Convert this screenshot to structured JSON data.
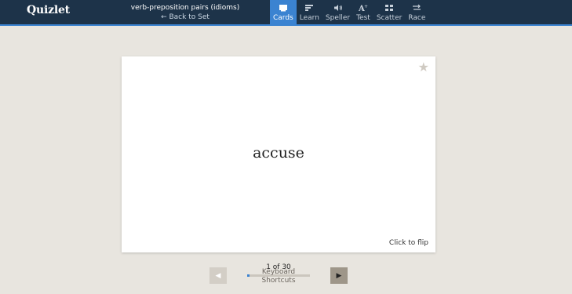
{
  "header": {
    "logo": "Quizlet",
    "set_title": "verb-preposition pairs (idioms)",
    "back_link": "← Back to Set",
    "modes": [
      {
        "label": "Cards",
        "icon": "cards-icon",
        "active": true
      },
      {
        "label": "Learn",
        "icon": "learn-icon",
        "active": false
      },
      {
        "label": "Speller",
        "icon": "speaker-icon",
        "active": false
      },
      {
        "label": "Test",
        "icon": "test-icon",
        "active": false
      },
      {
        "label": "Scatter",
        "icon": "scatter-icon",
        "active": false
      },
      {
        "label": "Race",
        "icon": "race-icon",
        "active": false
      }
    ]
  },
  "card": {
    "term": "accuse",
    "flip_hint": "Click to flip",
    "star_icon": "★"
  },
  "navigation": {
    "counter": "1 of 30",
    "progress_fraction": 0.033,
    "shortcuts_line1": "Keyboard",
    "shortcuts_line2": "Shortcuts",
    "prev_glyph": "◀",
    "next_glyph": "▶"
  },
  "colors": {
    "topbar": "#1d3349",
    "accent": "#3b83d1",
    "background": "#e8e5df"
  }
}
